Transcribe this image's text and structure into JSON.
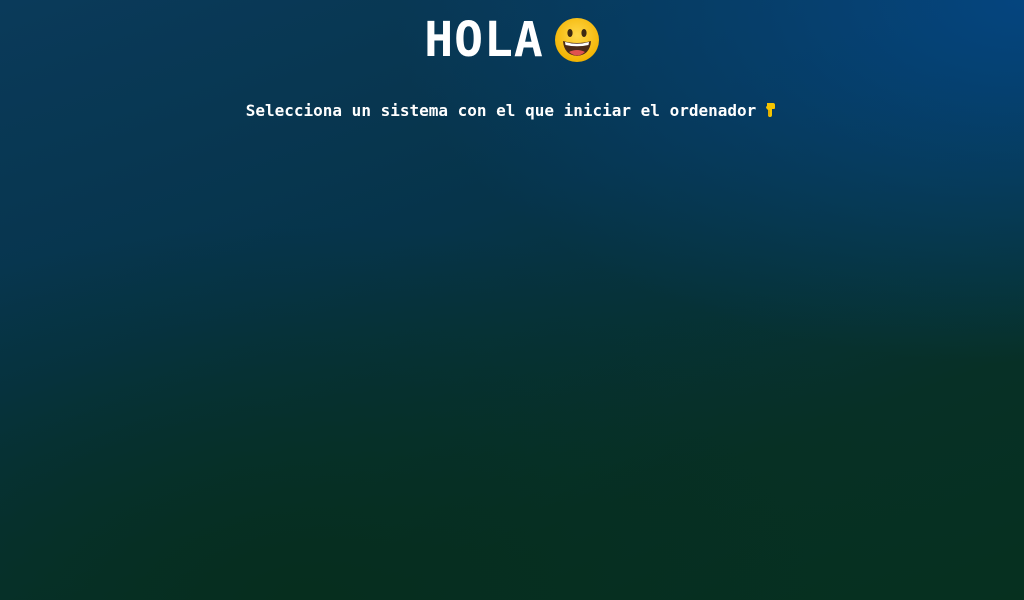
{
  "greeting": {
    "title": "HOLA",
    "title_icon": "grinning-face-icon"
  },
  "prompt": {
    "text": "Selecciona un sistema con el que iniciar el ordenador",
    "icon": "pointing-down-hand-icon"
  },
  "colors": {
    "background_top_right": "#05457f",
    "background_bottom": "#06301f",
    "text": "#ffffff",
    "emoji_yellow": "#f5c400"
  }
}
